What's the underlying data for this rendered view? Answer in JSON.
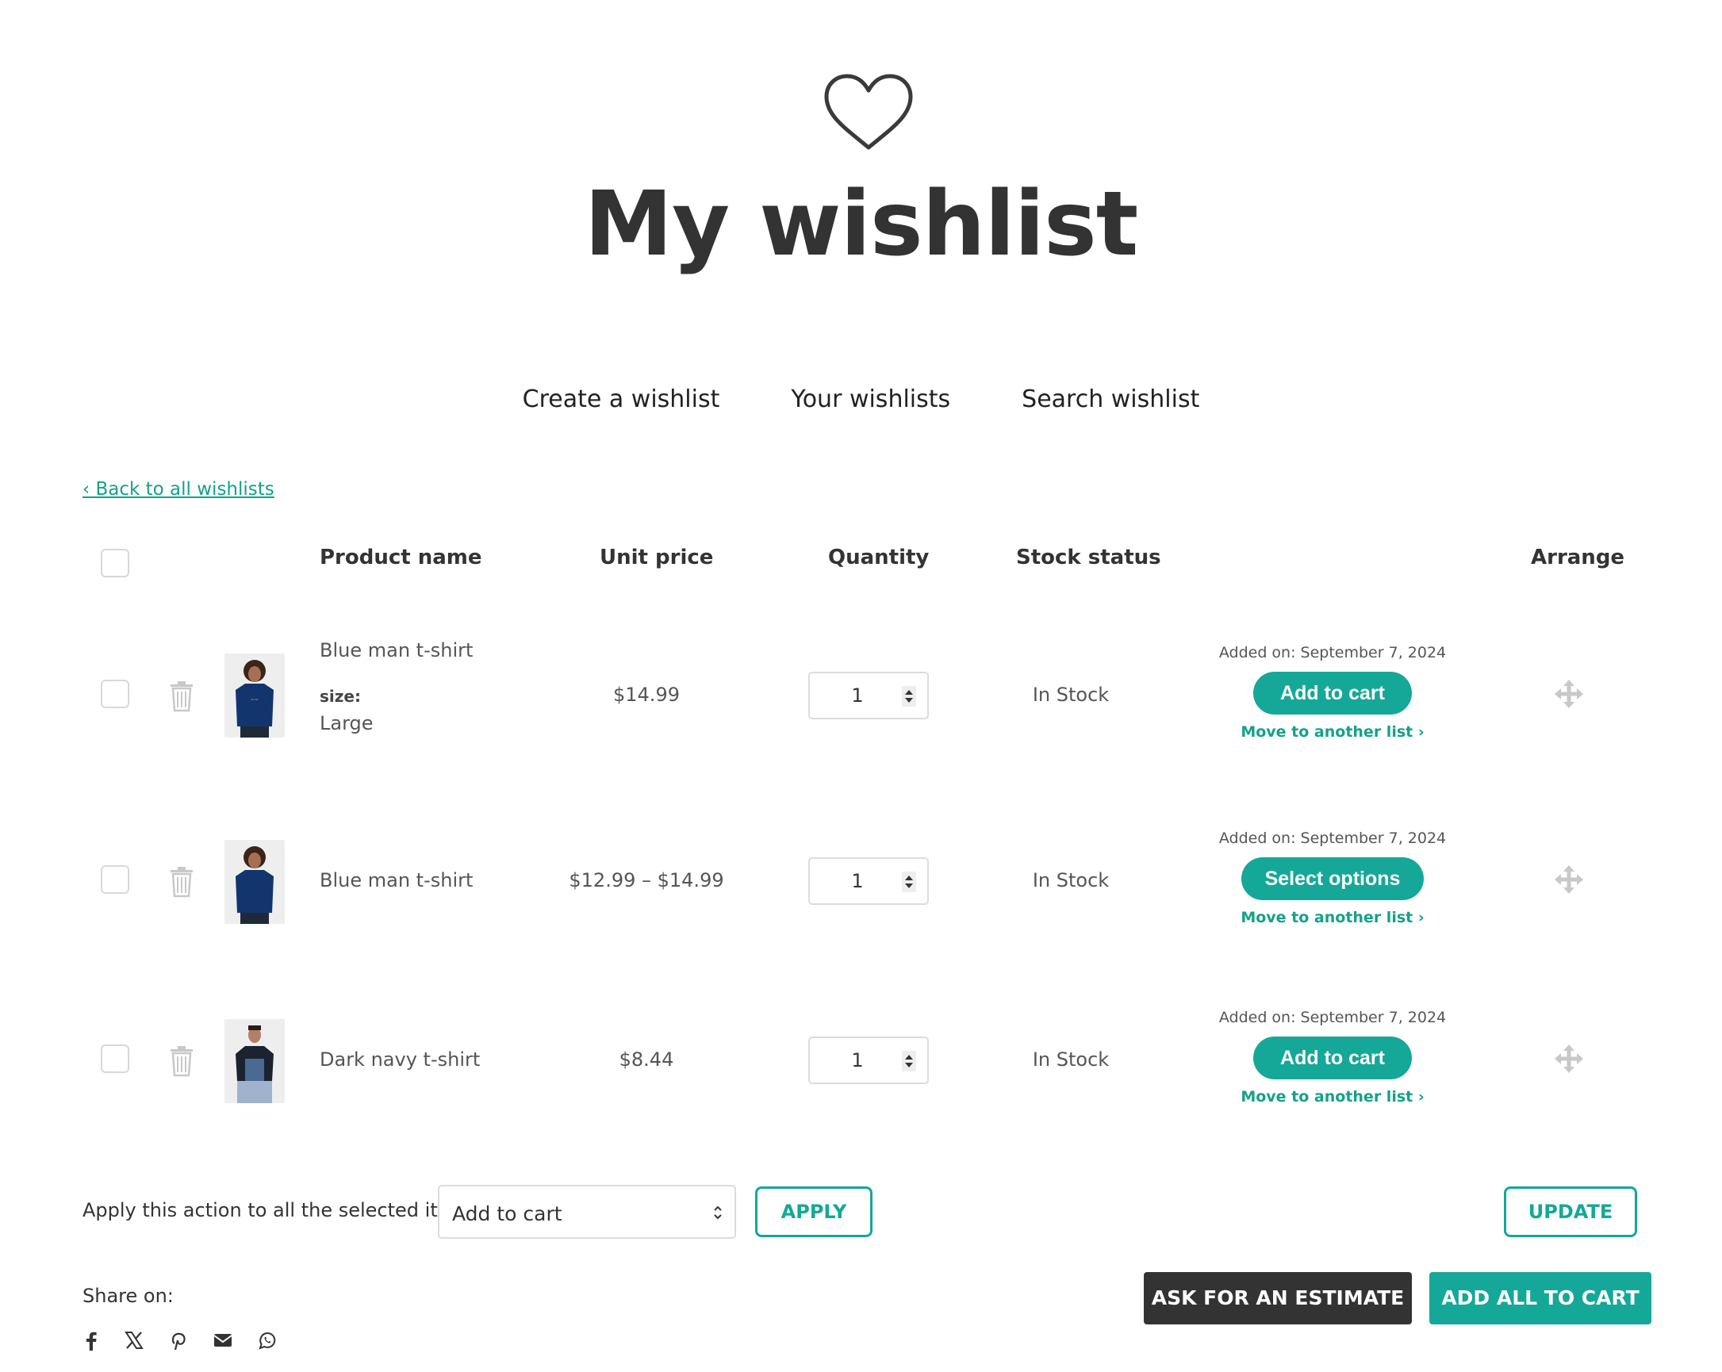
{
  "page": {
    "title": "My wishlist",
    "accent_color": "#15a898",
    "dark_color": "#333333"
  },
  "nav": {
    "items": [
      "Create a wishlist",
      "Your wishlists",
      "Search wishlist"
    ]
  },
  "back_link": "‹ Back to all wishlists",
  "table": {
    "headers": {
      "product_name": "Product name",
      "unit_price": "Unit price",
      "quantity": "Quantity",
      "stock_status": "Stock status",
      "arrange": "Arrange"
    },
    "rows": [
      {
        "name": "Blue man t-shirt",
        "variation_label": "size:",
        "variation_value": "Large",
        "price": "$14.99",
        "quantity": "1",
        "stock": "In Stock",
        "added_on": "Added on: September 7, 2024",
        "action": "Add to cart",
        "move": "Move to another list ›",
        "image_icon": "blue-tshirt-model-thumbnail"
      },
      {
        "name": "Blue man t-shirt",
        "price": "$12.99 – $14.99",
        "quantity": "1",
        "stock": "In Stock",
        "added_on": "Added on: September 7, 2024",
        "action": "Select options",
        "move": "Move to another list ›",
        "image_icon": "blue-tshirt-model-thumbnail"
      },
      {
        "name": "Dark navy t-shirt",
        "price": "$8.44",
        "quantity": "1",
        "stock": "In Stock",
        "added_on": "Added on: September 7, 2024",
        "action": "Add to cart",
        "move": "Move to another list ›",
        "image_icon": "navy-tshirt-model-thumbnail"
      }
    ]
  },
  "bulk": {
    "label": "Apply this action to all the selected items:",
    "selected_option": "Add to cart",
    "apply_label": "APPLY",
    "update_label": "UPDATE"
  },
  "share": {
    "label": "Share on:",
    "icons": [
      "facebook-icon",
      "x-icon",
      "pinterest-icon",
      "email-icon",
      "whatsapp-icon"
    ]
  },
  "footer_buttons": {
    "estimate": "ASK FOR AN ESTIMATE",
    "add_all": "ADD ALL TO CART"
  }
}
